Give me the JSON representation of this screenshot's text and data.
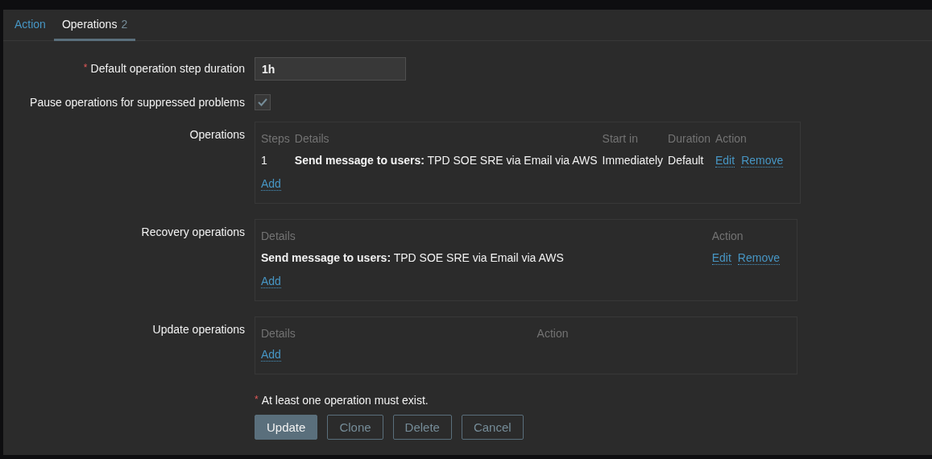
{
  "tabs": [
    {
      "label": "Action",
      "selected": false
    },
    {
      "label": "Operations",
      "count": "2",
      "selected": true
    }
  ],
  "step_duration": {
    "marker": "*",
    "label": "Default operation step duration",
    "value": "1h"
  },
  "pause": {
    "label": "Pause operations for suppressed problems",
    "checked": true
  },
  "sections": [
    {
      "label": "Operations",
      "columns": [
        "Steps",
        "Details",
        "Start in",
        "Duration",
        "Action"
      ],
      "rows": [
        {
          "cells": [
            "1",
            "**Send message to users:** TPD SOE SRE via Email via AWS",
            "Immediately",
            "Default"
          ],
          "actions": [
            "Edit",
            "Remove"
          ]
        }
      ],
      "add": "Add"
    },
    {
      "label": "Recovery operations",
      "columns": [
        "Details",
        "Action"
      ],
      "rows": [
        {
          "cells": [
            "**Send message to users:** TPD SOE SRE via Email via AWS"
          ],
          "actions": [
            "Edit",
            "Remove"
          ]
        }
      ],
      "add": "Add"
    },
    {
      "label": "Update operations",
      "columns": [
        "Details",
        "Action"
      ],
      "add": "Add"
    }
  ],
  "note": {
    "marker": "*",
    "text": "At least one operation must exist."
  },
  "buttons": [
    {
      "label": "Update",
      "kind": "primary"
    },
    {
      "label": "Clone",
      "kind": "secondary"
    },
    {
      "label": "Delete",
      "kind": "secondary"
    },
    {
      "label": "Cancel",
      "kind": "secondary"
    }
  ]
}
